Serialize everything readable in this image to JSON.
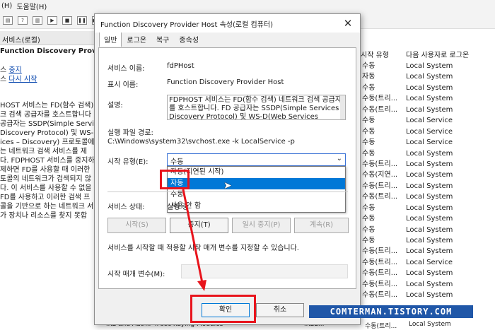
{
  "bg": {
    "menu": [
      "(H)",
      "도움말(H)"
    ],
    "header_left": "서비스(로컬)",
    "svc_title": "Function Discovery Provider Host",
    "action_stop_link": "중지",
    "action_stop_suffix": "스",
    "action_restart_link": "다시 시작",
    "action_restart_prefix": "스",
    "desc_lines": [
      "HOST 서비스는 FD(함수 검색)",
      "크 검색 공급자를 호스트합니다",
      "공급자는 SSDP(Simple Service",
      "Discovery Protocol) 및 WS-D(Web",
      "ices – Discovery) 프로토콜에 시",
      "는 네트워크 검색 서비스를 제",
      "다. FDPHOST 서비스를 중지하",
      "제하면 FD를 사용할 때 이러한",
      "토콜의 네트워크가 검색되지 않",
      "다. 이 서비스를 사용할 수 없을",
      " FD를 사용하고 이러한 검색 프",
      "콜을 기반으로 하는 네트워크 서",
      "가 장치나 리소스를 찾지 못합"
    ],
    "col_headers": [
      "시작 유형",
      "다음 사용자로 로그온"
    ],
    "rows": [
      [
        "수동",
        "Local System"
      ],
      [
        "자동",
        "Local System"
      ],
      [
        "수동",
        "Local System"
      ],
      [
        "수동(트리...",
        "Local System"
      ],
      [
        "수동(트리...",
        "Local System"
      ],
      [
        "수동",
        "Local Service"
      ],
      [
        "수동",
        "Local Service"
      ],
      [
        "수동",
        "Local Service"
      ],
      [
        "수동",
        "Local System"
      ],
      [
        "수동(트리...",
        "Local System"
      ],
      [
        "수동(지연...",
        "Local System"
      ],
      [
        "수동(트리...",
        "Local System"
      ],
      [
        "수동(트리...",
        "Local System"
      ],
      [
        "수동",
        "Local System"
      ],
      [
        "수동",
        "Local System"
      ],
      [
        "수동",
        "Local System"
      ],
      [
        "수동",
        "Local System"
      ],
      [
        "수동(트리...",
        "Local System"
      ],
      [
        "수동(트리...",
        "Local Service"
      ],
      [
        "수동(트리...",
        "Local System"
      ],
      [
        "수동(트리...",
        "Local System"
      ],
      [
        "수동(트리...",
        "Local System"
      ]
    ],
    "bottom_row": [
      "IKE and AuthIP IPsec Keying Modules",
      "IKEE...",
      "수동(트리...",
      "Local System"
    ]
  },
  "dialog": {
    "title": "Function Discovery Provider Host 속성(로컬 컴퓨터)",
    "close": "✕",
    "tabs": [
      "일반",
      "로그온",
      "복구",
      "종속성"
    ],
    "service_name_label": "서비스 이름:",
    "service_name_value": "fdPHost",
    "display_name_label": "표시 이름:",
    "display_name_value": "Function Discovery Provider Host",
    "desc_label": "설명:",
    "desc_text": "FDPHOST 서비스는 FD(함수 검색) 네트워크 검색 공급자를 호스트합니다. FD 공급자는 SSDP(Simple Services Discovery Protocol) 및 WS-D(Web Services",
    "exe_label": "실행 파일 경로:",
    "exe_value": "C:\\Windows\\system32\\svchost.exe -k LocalService -p",
    "startup_label": "시작 유형(E):",
    "startup_value": "수동",
    "startup_options": [
      "자동(지연된 시작)",
      "자동",
      "수동",
      "사용 안 함"
    ],
    "startup_selected_index": 1,
    "status_label": "서비스 상태:",
    "status_value": "실행 중",
    "btn_start": "시작(S)",
    "btn_stop": "중지(T)",
    "btn_pause": "일시 중지(P)",
    "btn_resume": "계속(R)",
    "params_note": "서비스를 시작할 때 적용할 시작 매개 변수를 지정할 수 있습니다.",
    "params_label": "시작 매개 변수(M):",
    "ok": "확인",
    "cancel": "취소"
  },
  "watermark": "COMTERMAN.TISTORY.COM",
  "colors": {
    "highlight": "#e8141c",
    "selection": "#0078d7",
    "watermark_bg": "#2057a8"
  }
}
